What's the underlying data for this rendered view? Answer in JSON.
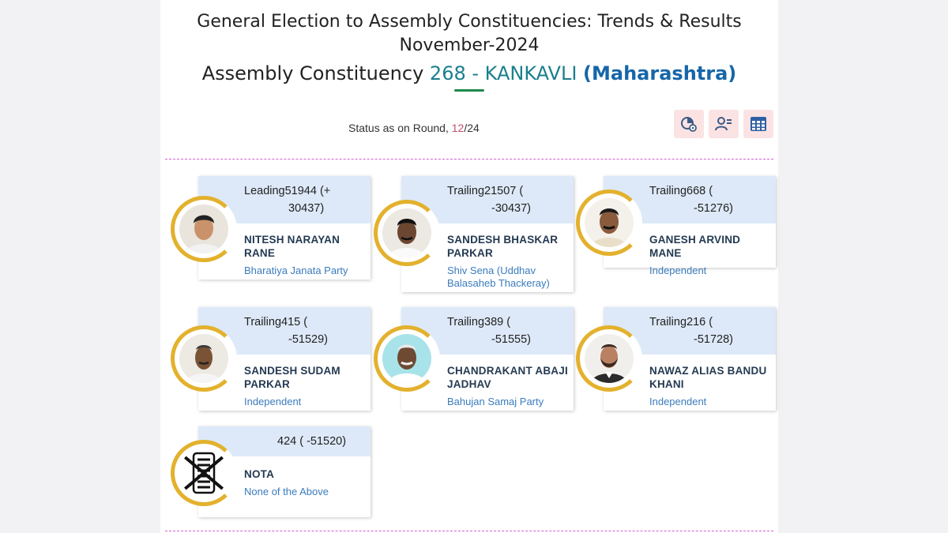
{
  "header": {
    "title_line1": "General Election to Assembly Constituencies: Trends & Results",
    "title_line2": "November-2024",
    "constituency_prefix": "Assembly Constituency",
    "constituency_number": "268 - KANKAVLI",
    "state": "(Maharashtra)"
  },
  "status": {
    "prefix": "Status as on Round,",
    "current_round": "12",
    "total_rounds": "/24"
  },
  "toolbar": {
    "icons": [
      "chart-settings-icon",
      "candidate-list-icon",
      "table-grid-icon"
    ]
  },
  "candidates": [
    {
      "status_line1": "Leading51944 (+",
      "status_line2": "30437)",
      "name_line1": "NITESH NARAYAN",
      "name_line2": "RANE",
      "party_line1": "Bharatiya Janata Party",
      "party_line2": "",
      "photo_bg": "#e9e4dc"
    },
    {
      "status_line1": "Trailing21507 (",
      "status_line2": "-30437)",
      "name_line1": "SANDESH BHASKAR",
      "name_line2": "PARKAR",
      "party_line1": "Shiv Sena (Uddhav",
      "party_line2": "Balasaheb Thackeray)",
      "photo_bg": "#ece8e2"
    },
    {
      "status_line1": "Trailing668 (",
      "status_line2": "-51276)",
      "name_line1": "GANESH ARVIND MANE",
      "name_line2": "",
      "party_line1": "Independent",
      "party_line2": "",
      "photo_bg": "#f4f0ea"
    },
    {
      "status_line1": "Trailing415 (",
      "status_line2": "-51529)",
      "name_line1": "SANDESH SUDAM",
      "name_line2": "PARKAR",
      "party_line1": "Independent",
      "party_line2": "",
      "photo_bg": "#ede9e3"
    },
    {
      "status_line1": "Trailing389 (",
      "status_line2": "-51555)",
      "name_line1": "CHANDRAKANT ABAJI",
      "name_line2": "JADHAV",
      "party_line1": "Bahujan Samaj Party",
      "party_line2": "",
      "photo_bg": "#a9e3ea"
    },
    {
      "status_line1": "Trailing216 (",
      "status_line2": "-51728)",
      "name_line1": "NAWAZ ALIAS BANDU",
      "name_line2": "KHANI",
      "party_line1": "Independent",
      "party_line2": "",
      "photo_bg": "#f1efec"
    }
  ],
  "nota": {
    "status": "424 ( -51520)",
    "name": "NOTA",
    "party": "None of the Above"
  },
  "colors": {
    "accent_gold": "#e3b12d",
    "card_header": "#dde9f8",
    "party_blue": "#3b7cbd",
    "divider": "#d35fd3",
    "round_highlight": "#c0506b"
  }
}
